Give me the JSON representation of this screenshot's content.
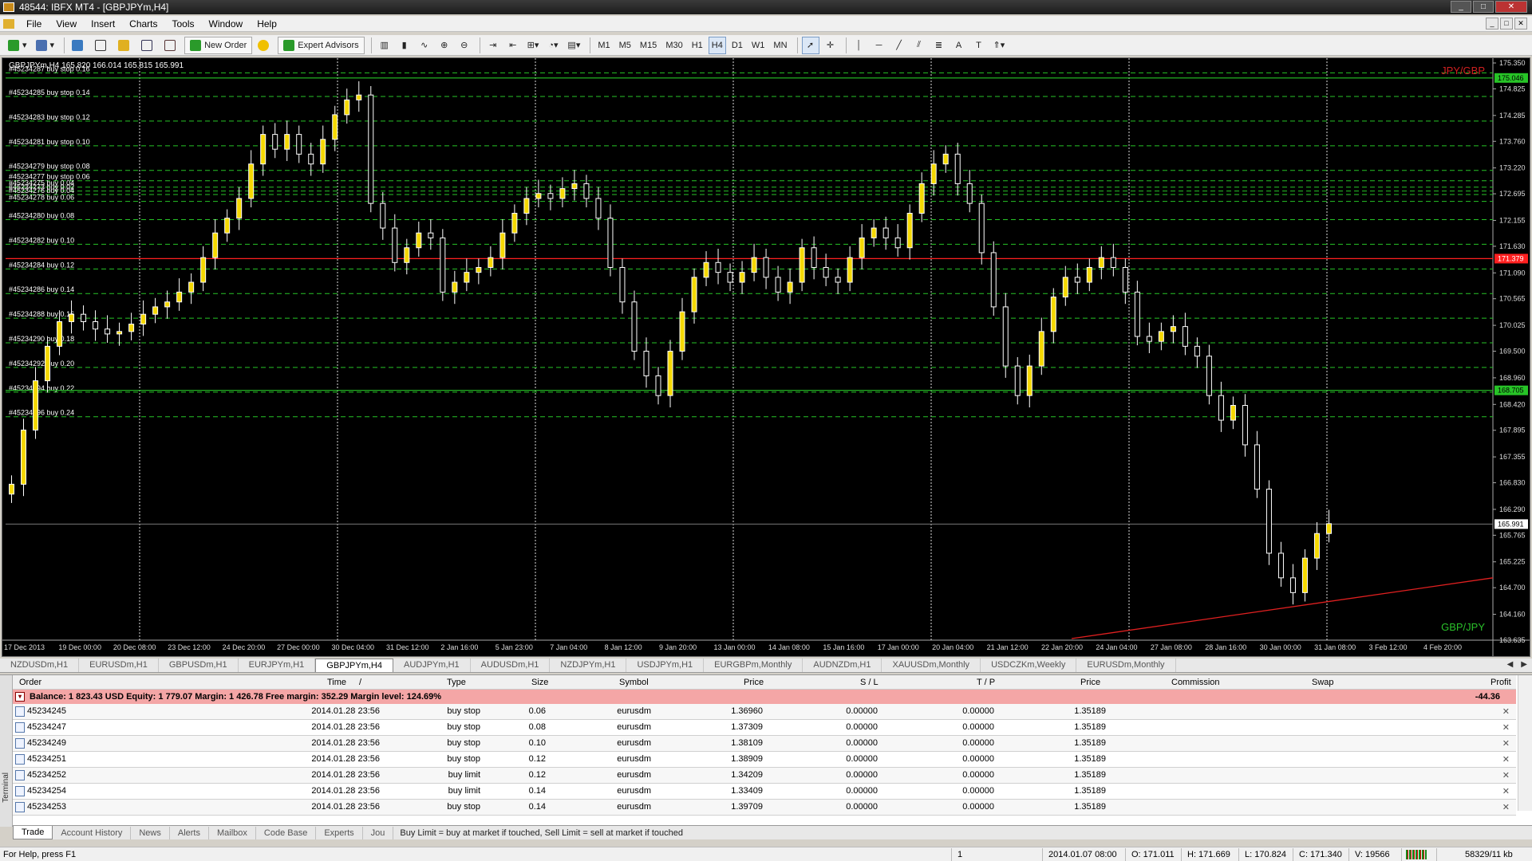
{
  "window": {
    "title": "48544: IBFX MT4 - [GBPJPYm,H4]",
    "controls": [
      "_",
      "□",
      "✕"
    ]
  },
  "menu": [
    "File",
    "View",
    "Insert",
    "Charts",
    "Tools",
    "Window",
    "Help"
  ],
  "mdi_controls": [
    "_",
    "□",
    "✕"
  ],
  "toolbar": {
    "new_order_label": "New Order",
    "expert_advisors_label": "Expert Advisors",
    "timeframes": [
      "M1",
      "M5",
      "M15",
      "M30",
      "H1",
      "H4",
      "D1",
      "W1",
      "MN"
    ],
    "active_timeframe": "H4"
  },
  "chart": {
    "header": "GBPJPYm,H4  165.820 166.014 165.815 165.991",
    "top_pair_label": "JPY/GBP",
    "bottom_pair_label": "GBP/JPY",
    "current_price": "165.991",
    "red_line_price": "171.379",
    "green_line_top_price": "175.046",
    "green_line_mid_price": "168.705",
    "price_ticks": [
      "175.350",
      "174.825",
      "174.285",
      "173.760",
      "173.220",
      "172.695",
      "172.155",
      "171.630",
      "171.090",
      "170.565",
      "170.025",
      "169.500",
      "168.960",
      "168.420",
      "167.895",
      "167.355",
      "166.830",
      "166.290",
      "165.765",
      "165.225",
      "164.700",
      "164.160",
      "163.635"
    ],
    "time_ticks": [
      "17 Dec 2013",
      "19 Dec 00:00",
      "20 Dec 08:00",
      "23 Dec 12:00",
      "24 Dec 20:00",
      "27 Dec 00:00",
      "30 Dec 04:00",
      "31 Dec 12:00",
      "2 Jan 16:00",
      "5 Jan 23:00",
      "7 Jan 04:00",
      "8 Jan 12:00",
      "9 Jan 20:00",
      "13 Jan 00:00",
      "14 Jan 08:00",
      "15 Jan 16:00",
      "17 Jan 00:00",
      "20 Jan 04:00",
      "21 Jan 12:00",
      "22 Jan 20:00",
      "24 Jan 04:00",
      "27 Jan 08:00",
      "28 Jan 16:00",
      "30 Jan 00:00",
      "31 Jan 08:00",
      "3 Feb 12:00",
      "4 Feb 20:00"
    ],
    "order_labels": [
      {
        "text": "#45234287 buy stop 0.16",
        "price": 175.15
      },
      {
        "text": "#45234285 buy stop 0.14",
        "price": 174.67
      },
      {
        "text": "#45234283 buy stop 0.12",
        "price": 174.17
      },
      {
        "text": "#45234281 buy stop 0.10",
        "price": 173.67
      },
      {
        "text": "#45234279 buy stop 0.08",
        "price": 173.17
      },
      {
        "text": "#45234277 buy stop 0.06",
        "price": 172.96
      },
      {
        "text": "#45234275 buy 0.04",
        "price": 172.83
      },
      {
        "text": "#45234273 buy 0.02",
        "price": 172.75
      },
      {
        "text": "#45234276 buy 0.04",
        "price": 172.68
      },
      {
        "text": "#45234278 buy 0.06",
        "price": 172.54
      },
      {
        "text": "#45234280 buy 0.08",
        "price": 172.17
      },
      {
        "text": "#45234282 buy 0.10",
        "price": 171.67
      },
      {
        "text": "#45234284 buy 0.12",
        "price": 171.17
      },
      {
        "text": "#45234286 buy 0.14",
        "price": 170.67
      },
      {
        "text": "#45234288 buy 0.16",
        "price": 170.17
      },
      {
        "text": "#45234290 buy 0.18",
        "price": 169.67
      },
      {
        "text": "#45234292 buy 0.20",
        "price": 169.17
      },
      {
        "text": "#45234294 buy 0.22",
        "price": 168.67
      },
      {
        "text": "#45234296 buy 0.24",
        "price": 168.17
      }
    ]
  },
  "chart_data": {
    "type": "candlestick",
    "ylim": [
      163.635,
      175.35
    ],
    "series_close": [
      166.8,
      167.9,
      168.9,
      169.6,
      170.1,
      170.25,
      170.1,
      169.95,
      169.85,
      169.9,
      170.05,
      170.25,
      170.4,
      170.5,
      170.7,
      170.9,
      171.4,
      171.9,
      172.2,
      172.6,
      173.3,
      173.9,
      173.6,
      173.9,
      173.5,
      173.3,
      173.8,
      174.3,
      174.6,
      174.7,
      172.5,
      172.0,
      171.3,
      171.6,
      171.9,
      171.8,
      170.7,
      170.9,
      171.1,
      171.2,
      171.4,
      171.9,
      172.3,
      172.6,
      172.7,
      172.6,
      172.8,
      172.9,
      172.6,
      172.2,
      171.2,
      170.5,
      169.5,
      169.0,
      168.6,
      169.5,
      170.3,
      171.0,
      171.3,
      171.1,
      170.9,
      171.1,
      171.4,
      171.0,
      170.7,
      170.9,
      171.6,
      171.2,
      171.0,
      170.9,
      171.4,
      171.8,
      172.0,
      171.8,
      171.6,
      172.3,
      172.9,
      173.3,
      173.5,
      172.9,
      172.5,
      171.5,
      170.4,
      169.2,
      168.6,
      169.2,
      169.9,
      170.6,
      171.0,
      170.9,
      171.2,
      171.4,
      171.2,
      170.7,
      169.8,
      169.7,
      169.9,
      170.0,
      169.6,
      169.4,
      168.6,
      168.1,
      168.4,
      167.6,
      166.7,
      165.4,
      164.9,
      164.6,
      165.3,
      165.8,
      166.0
    ]
  },
  "symbol_tabs": [
    "NZDUSDm,H1",
    "EURUSDm,H1",
    "GBPUSDm,H1",
    "EURJPYm,H1",
    "GBPJPYm,H4",
    "AUDJPYm,H1",
    "AUDUSDm,H1",
    "NZDJPYm,H1",
    "USDJPYm,H1",
    "EURGBPm,Monthly",
    "AUDNZDm,H1",
    "XAUUSDm,Monthly",
    "USDCZKm,Weekly",
    "EURUSDm,Monthly"
  ],
  "active_symbol_tab": "GBPJPYm,H4",
  "terminal": {
    "side_label": "Terminal",
    "columns": [
      "Order",
      "/",
      "Time",
      "Type",
      "Size",
      "Symbol",
      "Price",
      "S / L",
      "T / P",
      "Price",
      "Commission",
      "Swap",
      "Profit"
    ],
    "balance_text": "Balance: 1 823.43 USD  Equity: 1 779.07  Margin: 1 426.78  Free margin: 352.29  Margin level: 124.69%",
    "balance_profit": "-44.36",
    "rows": [
      {
        "order": "45234245",
        "time": "2014.01.28 23:56",
        "type": "buy stop",
        "size": "0.06",
        "symbol": "eurusdm",
        "price": "1.36960",
        "sl": "0.00000",
        "tp": "0.00000",
        "cur": "1.35189"
      },
      {
        "order": "45234247",
        "time": "2014.01.28 23:56",
        "type": "buy stop",
        "size": "0.08",
        "symbol": "eurusdm",
        "price": "1.37309",
        "sl": "0.00000",
        "tp": "0.00000",
        "cur": "1.35189"
      },
      {
        "order": "45234249",
        "time": "2014.01.28 23:56",
        "type": "buy stop",
        "size": "0.10",
        "symbol": "eurusdm",
        "price": "1.38109",
        "sl": "0.00000",
        "tp": "0.00000",
        "cur": "1.35189"
      },
      {
        "order": "45234251",
        "time": "2014.01.28 23:56",
        "type": "buy stop",
        "size": "0.12",
        "symbol": "eurusdm",
        "price": "1.38909",
        "sl": "0.00000",
        "tp": "0.00000",
        "cur": "1.35189"
      },
      {
        "order": "45234252",
        "time": "2014.01.28 23:56",
        "type": "buy limit",
        "size": "0.12",
        "symbol": "eurusdm",
        "price": "1.34209",
        "sl": "0.00000",
        "tp": "0.00000",
        "cur": "1.35189"
      },
      {
        "order": "45234254",
        "time": "2014.01.28 23:56",
        "type": "buy limit",
        "size": "0.14",
        "symbol": "eurusdm",
        "price": "1.33409",
        "sl": "0.00000",
        "tp": "0.00000",
        "cur": "1.35189"
      },
      {
        "order": "45234253",
        "time": "2014.01.28 23:56",
        "type": "buy stop",
        "size": "0.14",
        "symbol": "eurusdm",
        "price": "1.39709",
        "sl": "0.00000",
        "tp": "0.00000",
        "cur": "1.35189"
      }
    ],
    "tabs": [
      "Trade",
      "Account History",
      "News",
      "Alerts",
      "Mailbox",
      "Code Base",
      "Experts",
      "Jou"
    ],
    "active_tab": "Trade",
    "hint": "Buy Limit = buy at market if touched, Sell Limit = sell at market if touched"
  },
  "status": {
    "help": "For Help, press F1",
    "profile": "1",
    "datetime": "2014.01.07 08:00",
    "open": "O: 171.011",
    "high": "H: 171.669",
    "low": "L: 170.824",
    "close": "C: 171.340",
    "volume": "V: 19566",
    "traffic": "58329/11 kb"
  },
  "colors": {
    "chart_bg": "#000000",
    "bull_candle": "#f5d800",
    "bear_candle": "#000000",
    "grid_line": "#ffffff",
    "order_line": "#27c427",
    "red_line": "#ff2020",
    "balance_row": "#f4a6a6"
  }
}
